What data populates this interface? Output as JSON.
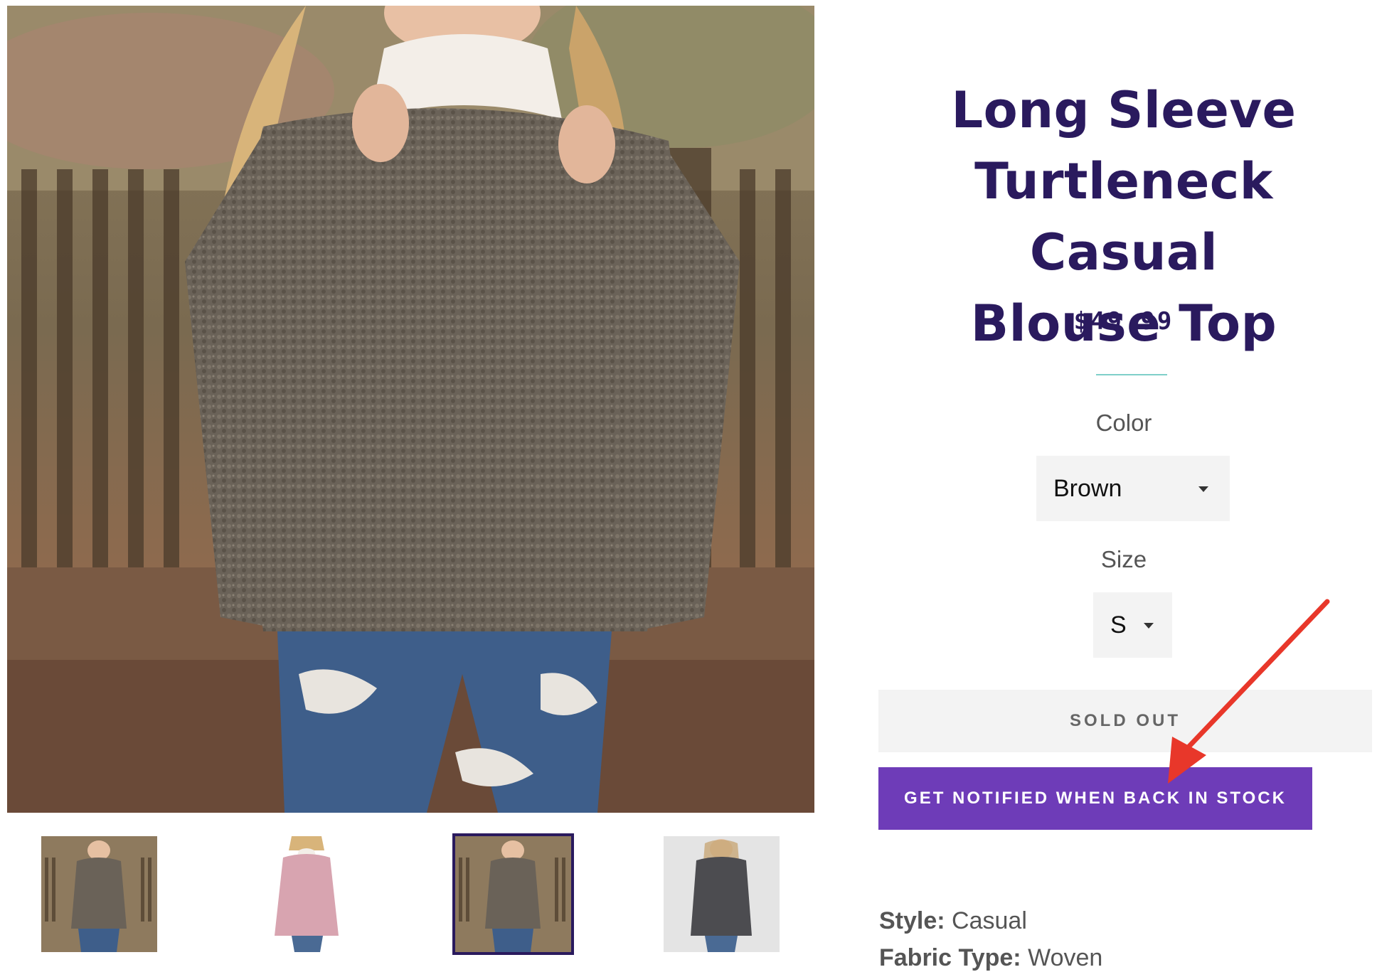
{
  "product": {
    "title_lines": [
      "Long Sleeve",
      "Turtleneck Casual",
      "Blouse Top"
    ],
    "price": "$49.99",
    "main_image_alt": "gray sherpa pullover"
  },
  "options": {
    "color": {
      "label": "Color",
      "value": "Brown"
    },
    "size": {
      "label": "Size",
      "value": "S"
    }
  },
  "buttons": {
    "sold_out": "SOLD OUT",
    "notify": "GET NOTIFIED WHEN BACK IN STOCK"
  },
  "specs": [
    {
      "key": "Style:",
      "value": "Casual"
    },
    {
      "key": "Fabric Type:",
      "value": "Woven"
    }
  ],
  "thumbnails": [
    {
      "color_name": "gray",
      "selected": false
    },
    {
      "color_name": "pink",
      "selected": false
    },
    {
      "color_name": "gray",
      "selected": true
    },
    {
      "color_name": "dark-gray",
      "selected": false
    }
  ],
  "colors": {
    "title": "#2a1a5e",
    "accent_button": "#6e3cb8",
    "divider": "#7fcfc9",
    "arrow": "#e8372a"
  }
}
